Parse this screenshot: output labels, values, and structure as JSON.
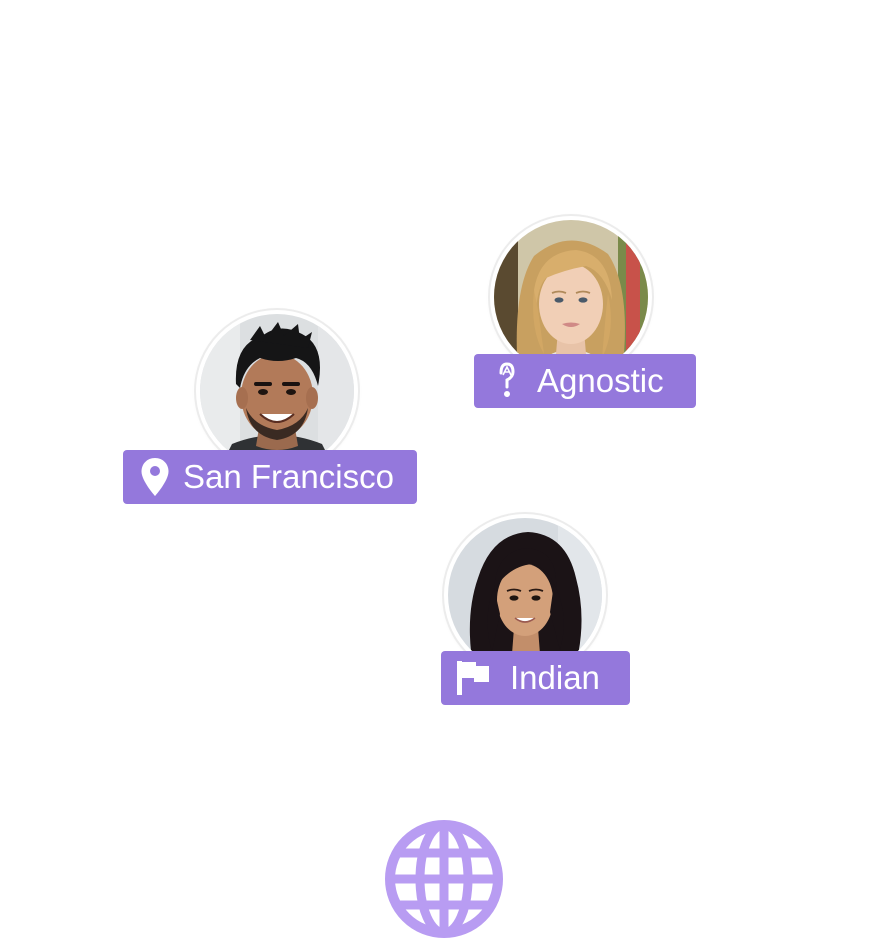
{
  "colors": {
    "tag_background": "#9478dc",
    "tag_text": "#ffffff",
    "globe": "#b89cf2",
    "avatar_ring": "#ececec"
  },
  "profiles": [
    {
      "avatar": "man-portrait-photo",
      "tag": {
        "icon": "location-pin-icon",
        "label": "San Francisco"
      }
    },
    {
      "avatar": "blonde-woman-portrait-photo",
      "tag": {
        "icon": "agnostic-symbol-icon",
        "label": "Agnostic"
      }
    },
    {
      "avatar": "dark-haired-woman-portrait-photo",
      "tag": {
        "icon": "flag-icon",
        "label": "Indian"
      }
    }
  ],
  "footer_icon": "globe-icon"
}
